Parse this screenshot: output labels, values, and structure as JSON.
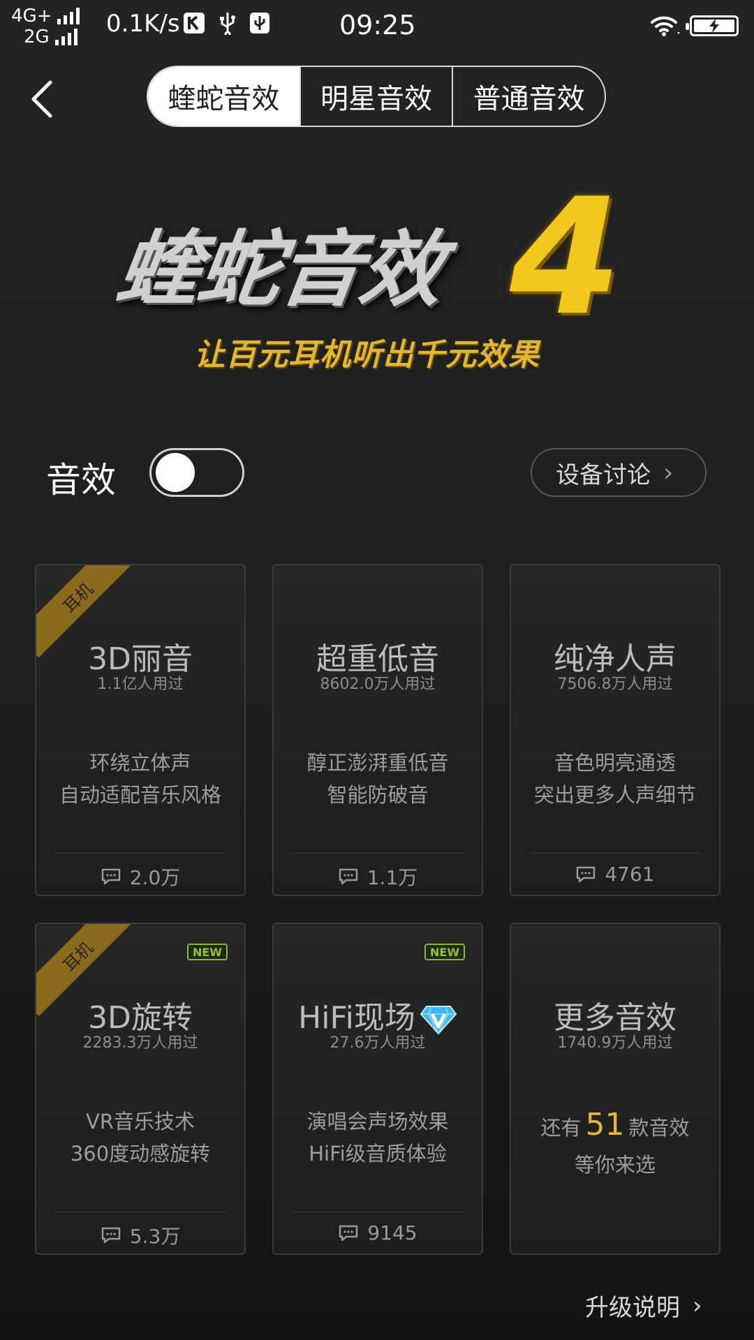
{
  "status_bar": {
    "net_top": "4G+",
    "net_bottom": "2G",
    "speed": "0.1K/s",
    "time": "09:25"
  },
  "tabs": [
    "蝰蛇音效",
    "明星音效",
    "普通音效"
  ],
  "banner": {
    "title": "蝰蛇音效",
    "number": "4",
    "subtitle": "让百元耳机听出千元效果"
  },
  "sound_toggle": {
    "label": "音效",
    "on": false
  },
  "device_discussion": {
    "label": "设备讨论",
    "chevron": "›"
  },
  "cards": [
    {
      "title": "3D丽音",
      "users": "1.1亿人用过",
      "desc1": "环绕立体声",
      "desc2": "自动适配音乐风格",
      "comments": "2.0万",
      "ribbon": "耳机"
    },
    {
      "title": "超重低音",
      "users": "8602.0万人用过",
      "desc1": "醇正澎湃重低音",
      "desc2": "智能防破音",
      "comments": "1.1万"
    },
    {
      "title": "纯净人声",
      "users": "7506.8万人用过",
      "desc1": "音色明亮通透",
      "desc2": "突出更多人声细节",
      "comments": "4761"
    },
    {
      "title": "3D旋转",
      "users": "2283.3万人用过",
      "desc1": "VR音乐技术",
      "desc2": "360度动感旋转",
      "comments": "5.3万",
      "ribbon": "耳机",
      "badge": "NEW"
    },
    {
      "title": "HiFi现场",
      "users": "27.6万人用过",
      "desc1": "演唱会声场效果",
      "desc2": "HiFi级音质体验",
      "comments": "9145",
      "badge": "NEW",
      "icon": "diamond-v-icon"
    }
  ],
  "more_card": {
    "title": "更多音效",
    "users": "1740.9万人用过",
    "prefix": "还有",
    "count": "51",
    "suffix": "款音效",
    "line2": "等你来选"
  },
  "upgrade": {
    "label": "升级说明",
    "chevron": "›"
  },
  "colors": {
    "accent_gold": "#e6b832",
    "new_green": "#7fc21f",
    "ribbon": "#8a6a1c"
  }
}
